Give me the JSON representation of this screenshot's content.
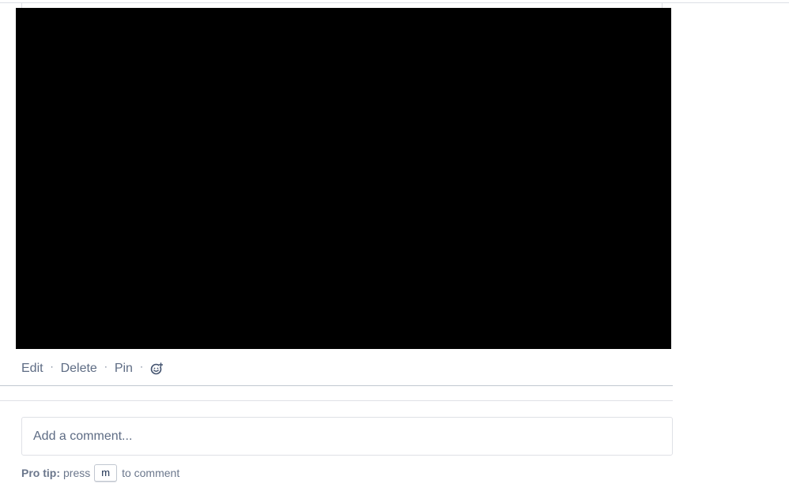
{
  "comment_actions": {
    "edit_label": "Edit",
    "delete_label": "Delete",
    "pin_label": "Pin",
    "separator": "·",
    "reaction_icon": "emoji-add-icon"
  },
  "comment_composer": {
    "placeholder": "Add a comment..."
  },
  "pro_tip": {
    "label": "Pro tip:",
    "text_before": "press",
    "key": "m",
    "text_after": "to comment"
  },
  "colors": {
    "media_background": "#000000",
    "text_muted": "#5e6c84"
  }
}
